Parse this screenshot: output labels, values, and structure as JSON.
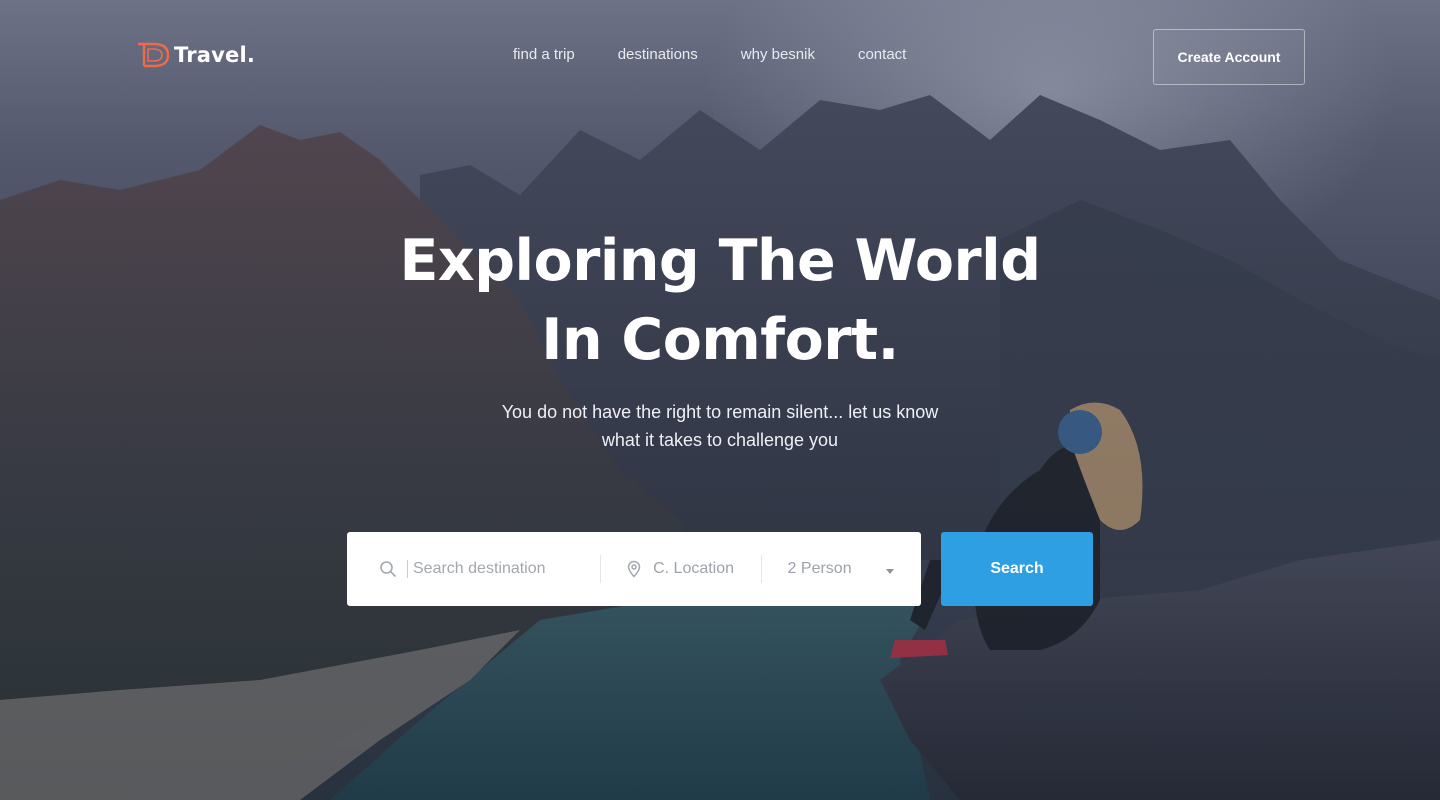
{
  "brand": {
    "name": "Travel.",
    "accent_color": "#f06a4a"
  },
  "nav": {
    "items": [
      {
        "label": "find a trip"
      },
      {
        "label": "destinations"
      },
      {
        "label": "why besnik"
      },
      {
        "label": "contact"
      }
    ],
    "cta_label": "Create Account"
  },
  "hero": {
    "title_line1": "Exploring The World",
    "title_line2": "In Comfort.",
    "subtitle_line1": "You do not have the right to remain silent... let us know",
    "subtitle_line2": "what it takes to challenge you"
  },
  "search": {
    "destination_placeholder": "Search destination",
    "location_value": "C. Location",
    "person_value": "2 Person",
    "button_label": "Search",
    "button_color": "#2f9fe4",
    "icons": {
      "destination": "search-icon",
      "location": "map-pin-icon",
      "person": "caret-down-icon"
    }
  }
}
